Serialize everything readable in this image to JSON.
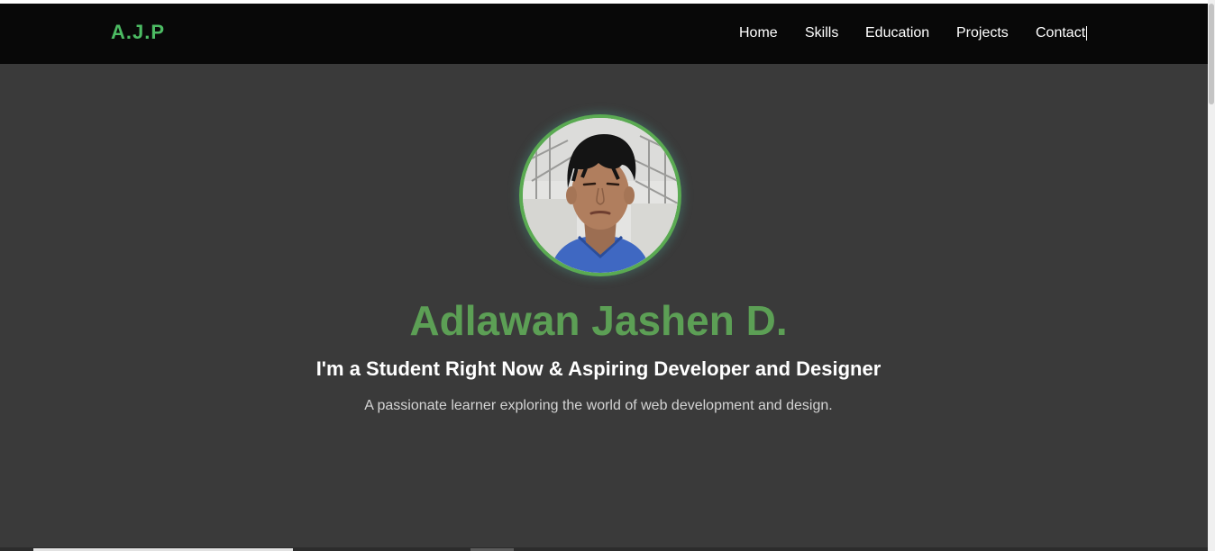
{
  "brand": {
    "logo_text": "A.J.P",
    "accent_color": "#4cbb63"
  },
  "nav": {
    "items": [
      {
        "label": "Home"
      },
      {
        "label": "Skills"
      },
      {
        "label": "Education"
      },
      {
        "label": "Projects"
      },
      {
        "label": "Contact"
      }
    ]
  },
  "hero": {
    "profile_photo": "profile-photo",
    "name": "Adlawan Jashen D.",
    "name_color": "#5c9f55",
    "subtitle": "I'm a Student Right Now & Aspiring Developer and Designer",
    "description": "A passionate learner exploring the world of web development and design."
  }
}
